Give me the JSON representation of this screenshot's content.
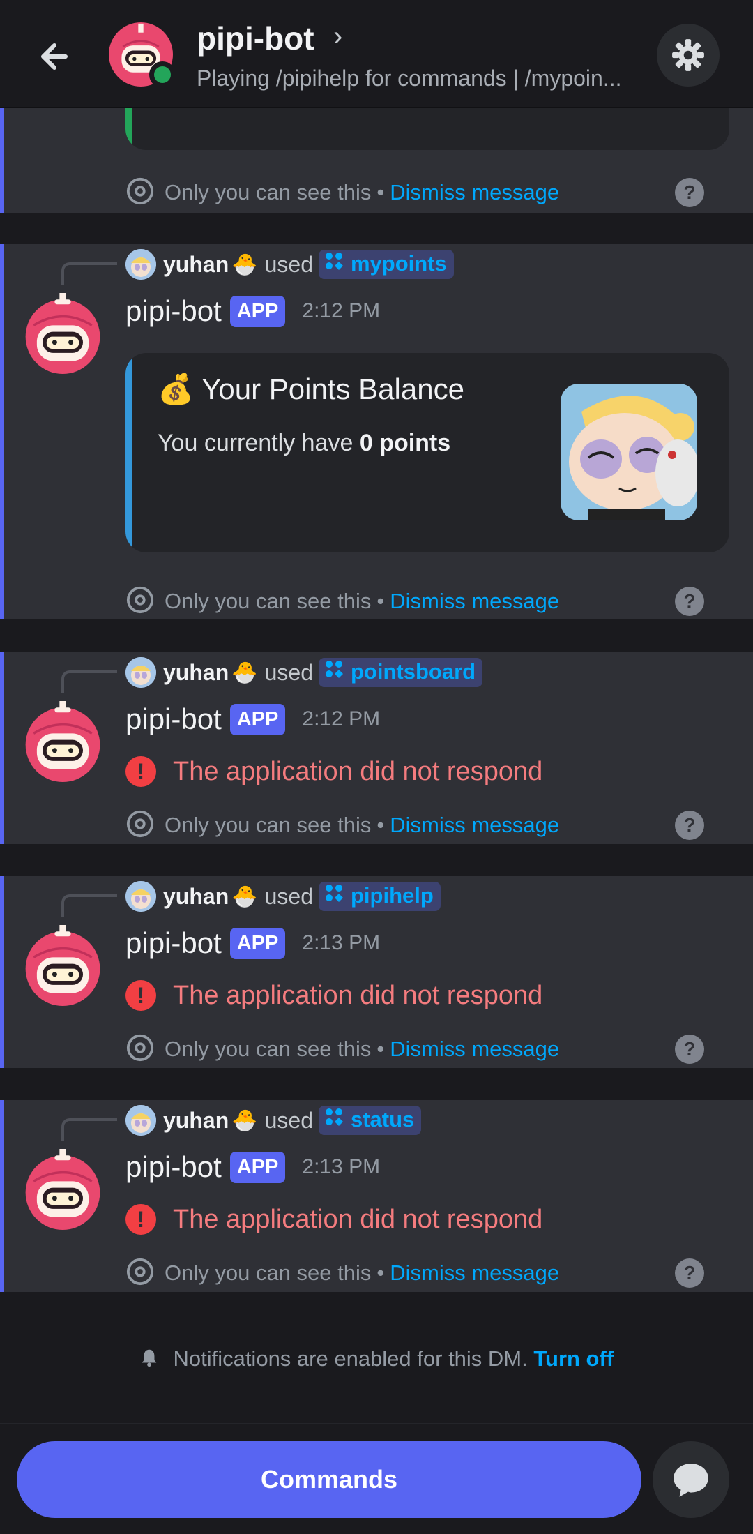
{
  "header": {
    "title": "pipi-bot",
    "subtitle": "Playing /pipihelp for commands | /mypoin...",
    "chevron": "›",
    "back_icon": "arrow-left-icon",
    "settings_icon": "gear-icon"
  },
  "ephemeral": {
    "label": "Only you can see this",
    "separator": "•",
    "dismiss": "Dismiss message",
    "help": "?"
  },
  "messages": [
    {
      "user": "yuhan",
      "user_emoji": "🐣",
      "used": "used",
      "command": "mypoints",
      "bot": "pipi-bot",
      "tag": "APP",
      "time": "2:12 PM",
      "embed": {
        "emoji": "💰",
        "title": "Your Points Balance",
        "desc_prefix": "You currently have ",
        "desc_bold": "0 points"
      }
    },
    {
      "user": "yuhan",
      "user_emoji": "🐣",
      "used": "used",
      "command": "pointsboard",
      "bot": "pipi-bot",
      "tag": "APP",
      "time": "2:12 PM",
      "error": "The application did not respond"
    },
    {
      "user": "yuhan",
      "user_emoji": "🐣",
      "used": "used",
      "command": "pipihelp",
      "bot": "pipi-bot",
      "tag": "APP",
      "time": "2:13 PM",
      "error": "The application did not respond"
    },
    {
      "user": "yuhan",
      "user_emoji": "🐣",
      "used": "used",
      "command": "status",
      "bot": "pipi-bot",
      "tag": "APP",
      "time": "2:13 PM",
      "error": "The application did not respond"
    }
  ],
  "notice": {
    "text": "Notifications are enabled for this DM.",
    "action": "Turn off"
  },
  "bottom": {
    "commands_label": "Commands"
  },
  "colors": {
    "accent": "#5865f2",
    "link": "#00a8fc",
    "error": "#f23f43",
    "online": "#23a55a"
  }
}
